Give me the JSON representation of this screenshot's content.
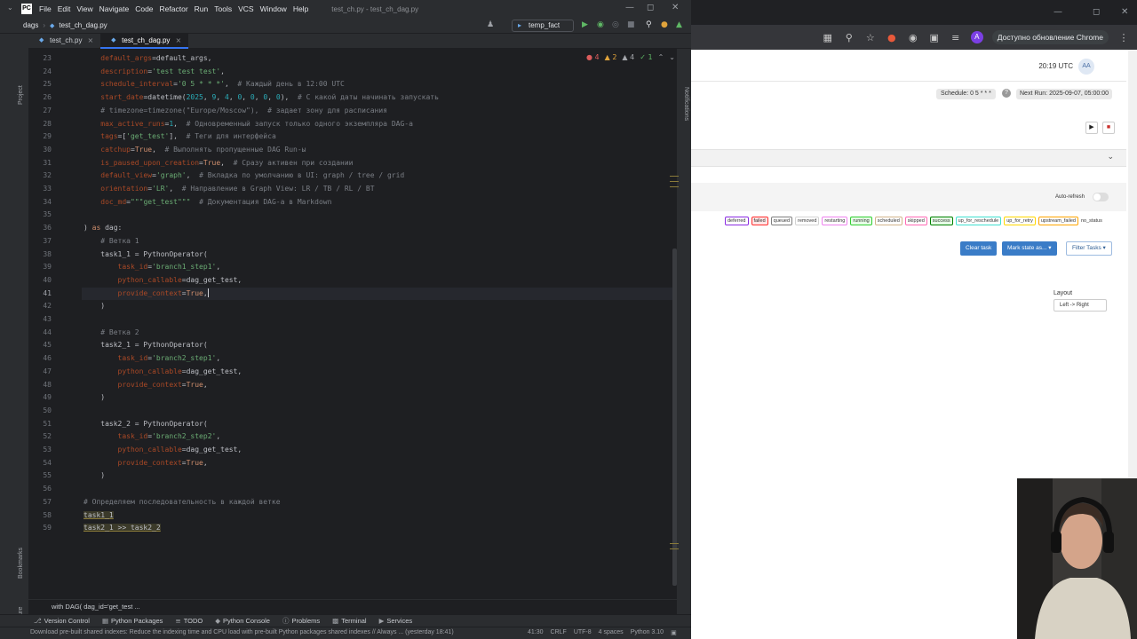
{
  "ide": {
    "menu": [
      "File",
      "Edit",
      "View",
      "Navigate",
      "Code",
      "Refactor",
      "Run",
      "Tools",
      "VCS",
      "Window",
      "Help"
    ],
    "window_title": "test_ch.py - test_ch_dag.py",
    "breadcrumb": {
      "folder": "dags",
      "file": "test_ch_dag.py"
    },
    "run_config": "temp_fact",
    "tabs": [
      {
        "label": "test_ch.py",
        "active": false
      },
      {
        "label": "test_ch_dag.py",
        "active": true
      }
    ],
    "left_tool_labels": {
      "project": "Project",
      "bookmarks": "Bookmarks",
      "structure": "Structure"
    },
    "right_tool_label": "Notifications",
    "inspections": {
      "errors": "4",
      "warnings": "2",
      "weak": "4",
      "ok": "1"
    },
    "line_numbers": [
      "23",
      "24",
      "25",
      "26",
      "27",
      "28",
      "29",
      "30",
      "31",
      "32",
      "33",
      "34",
      "35",
      "36",
      "37",
      "38",
      "39",
      "40",
      "41",
      "42",
      "43",
      "44",
      "45",
      "46",
      "47",
      "48",
      "49",
      "50",
      "51",
      "52",
      "53",
      "54",
      "55",
      "56",
      "57",
      "58",
      "59"
    ],
    "current_line": "41",
    "bottom_breadcrumb": "with DAG(   dag_id='get_test ...",
    "tool_windows": [
      "Version Control",
      "Python Packages",
      "TODO",
      "Python Console",
      "Problems",
      "Terminal",
      "Services"
    ],
    "status": {
      "message": "Download pre-built shared indexes: Reduce the indexing time and CPU load with pre-built Python packages shared indexes // Always ... (yesterday 18:41)",
      "position": "41:30",
      "line_sep": "CRLF",
      "encoding": "UTF-8",
      "indent": "4 spaces",
      "interpreter": "Python 3.10"
    }
  },
  "browser": {
    "update_button": "Доступно обновление Chrome",
    "time": "20:19 UTC",
    "avatar": "AA",
    "schedule": "Schedule: 0 5 * * *",
    "next_run": "Next Run: 2025-09-07, 05:00:00",
    "auto_refresh": "Auto-refresh",
    "states": [
      "deferred",
      "failed",
      "queued",
      "removed",
      "restarting",
      "running",
      "scheduled",
      "skipped",
      "success",
      "up_for_reschedule",
      "up_for_retry",
      "upstream_failed",
      "no_status"
    ],
    "buttons": {
      "clear": "Clear task",
      "mark": "Mark state as... ▾",
      "filter": "Filter Tasks ▾"
    },
    "layout_label": "Layout",
    "layout_value": "Left -> Right"
  }
}
